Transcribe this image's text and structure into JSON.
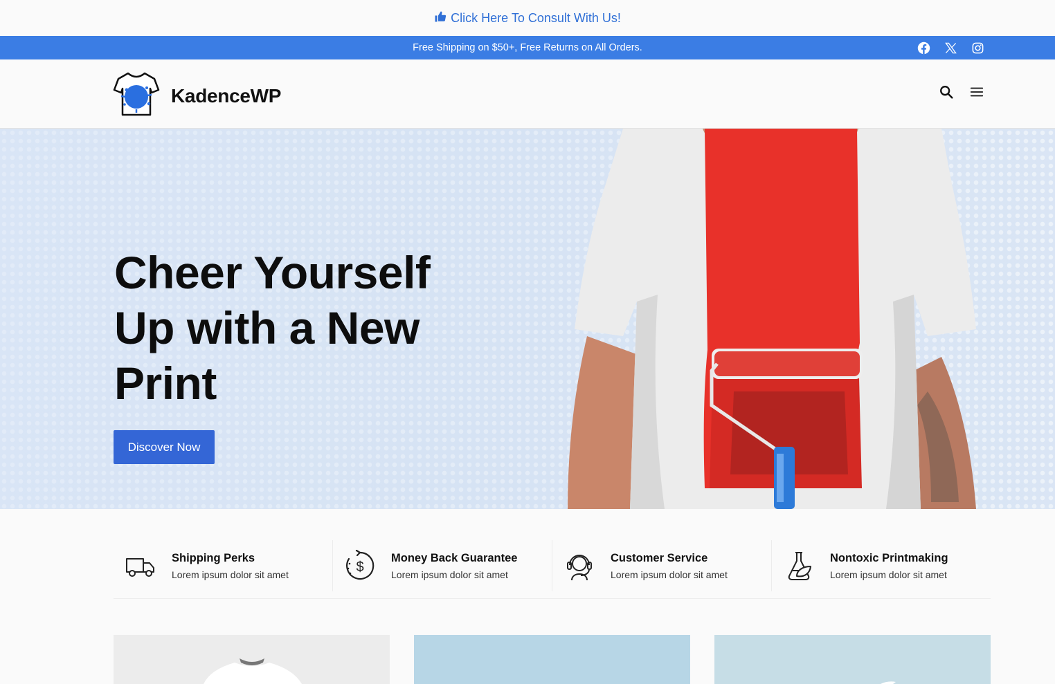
{
  "consult": {
    "text": "Click Here To Consult With Us!"
  },
  "notice": {
    "text": "Free Shipping on $50+, Free Returns on All Orders."
  },
  "social": [
    "facebook-icon",
    "x-icon",
    "instagram-icon"
  ],
  "header": {
    "logo_text": "KadenceWP"
  },
  "hero": {
    "title": "Cheer Yourself Up with a New Print",
    "button": "Discover Now"
  },
  "features": [
    {
      "icon": "truck-icon",
      "title": "Shipping Perks",
      "subtitle": "Lorem ipsum dolor sit amet"
    },
    {
      "icon": "money-back-icon",
      "title": "Money Back Guarantee",
      "subtitle": "Lorem ipsum dolor sit amet"
    },
    {
      "icon": "headset-icon",
      "title": "Customer Service",
      "subtitle": "Lorem ipsum dolor sit amet"
    },
    {
      "icon": "flask-leaf-icon",
      "title": "Nontoxic Printmaking",
      "subtitle": "Lorem ipsum dolor sit amet"
    }
  ],
  "colors": {
    "accent": "#3b7de4",
    "button": "#3466d6",
    "link": "#2f6fd6",
    "paint": "#e8312a"
  }
}
